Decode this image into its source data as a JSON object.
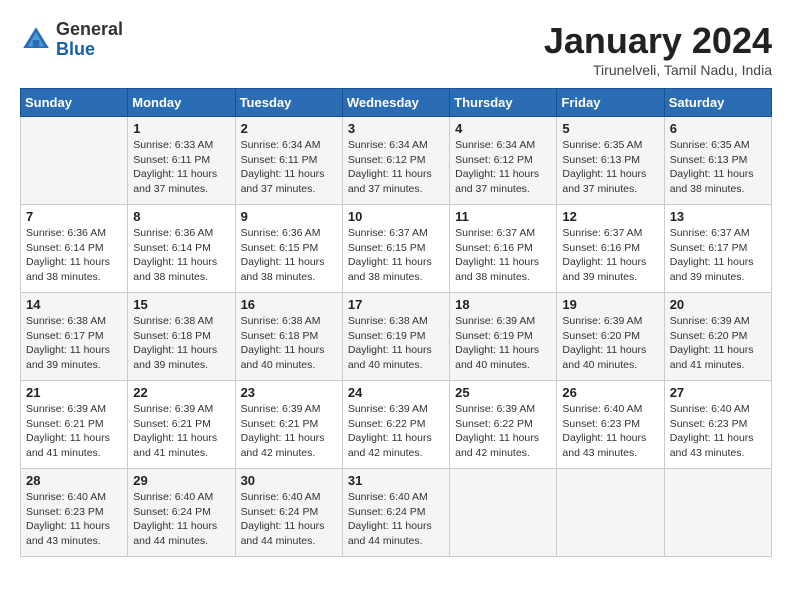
{
  "header": {
    "logo": {
      "general": "General",
      "blue": "Blue"
    },
    "title": "January 2024",
    "location": "Tirunelveli, Tamil Nadu, India"
  },
  "calendar": {
    "days_of_week": [
      "Sunday",
      "Monday",
      "Tuesday",
      "Wednesday",
      "Thursday",
      "Friday",
      "Saturday"
    ],
    "weeks": [
      [
        {
          "day": "",
          "info": ""
        },
        {
          "day": "1",
          "info": "Sunrise: 6:33 AM\nSunset: 6:11 PM\nDaylight: 11 hours\nand 37 minutes."
        },
        {
          "day": "2",
          "info": "Sunrise: 6:34 AM\nSunset: 6:11 PM\nDaylight: 11 hours\nand 37 minutes."
        },
        {
          "day": "3",
          "info": "Sunrise: 6:34 AM\nSunset: 6:12 PM\nDaylight: 11 hours\nand 37 minutes."
        },
        {
          "day": "4",
          "info": "Sunrise: 6:34 AM\nSunset: 6:12 PM\nDaylight: 11 hours\nand 37 minutes."
        },
        {
          "day": "5",
          "info": "Sunrise: 6:35 AM\nSunset: 6:13 PM\nDaylight: 11 hours\nand 37 minutes."
        },
        {
          "day": "6",
          "info": "Sunrise: 6:35 AM\nSunset: 6:13 PM\nDaylight: 11 hours\nand 38 minutes."
        }
      ],
      [
        {
          "day": "7",
          "info": "Sunrise: 6:36 AM\nSunset: 6:14 PM\nDaylight: 11 hours\nand 38 minutes."
        },
        {
          "day": "8",
          "info": "Sunrise: 6:36 AM\nSunset: 6:14 PM\nDaylight: 11 hours\nand 38 minutes."
        },
        {
          "day": "9",
          "info": "Sunrise: 6:36 AM\nSunset: 6:15 PM\nDaylight: 11 hours\nand 38 minutes."
        },
        {
          "day": "10",
          "info": "Sunrise: 6:37 AM\nSunset: 6:15 PM\nDaylight: 11 hours\nand 38 minutes."
        },
        {
          "day": "11",
          "info": "Sunrise: 6:37 AM\nSunset: 6:16 PM\nDaylight: 11 hours\nand 38 minutes."
        },
        {
          "day": "12",
          "info": "Sunrise: 6:37 AM\nSunset: 6:16 PM\nDaylight: 11 hours\nand 39 minutes."
        },
        {
          "day": "13",
          "info": "Sunrise: 6:37 AM\nSunset: 6:17 PM\nDaylight: 11 hours\nand 39 minutes."
        }
      ],
      [
        {
          "day": "14",
          "info": "Sunrise: 6:38 AM\nSunset: 6:17 PM\nDaylight: 11 hours\nand 39 minutes."
        },
        {
          "day": "15",
          "info": "Sunrise: 6:38 AM\nSunset: 6:18 PM\nDaylight: 11 hours\nand 39 minutes."
        },
        {
          "day": "16",
          "info": "Sunrise: 6:38 AM\nSunset: 6:18 PM\nDaylight: 11 hours\nand 40 minutes."
        },
        {
          "day": "17",
          "info": "Sunrise: 6:38 AM\nSunset: 6:19 PM\nDaylight: 11 hours\nand 40 minutes."
        },
        {
          "day": "18",
          "info": "Sunrise: 6:39 AM\nSunset: 6:19 PM\nDaylight: 11 hours\nand 40 minutes."
        },
        {
          "day": "19",
          "info": "Sunrise: 6:39 AM\nSunset: 6:20 PM\nDaylight: 11 hours\nand 40 minutes."
        },
        {
          "day": "20",
          "info": "Sunrise: 6:39 AM\nSunset: 6:20 PM\nDaylight: 11 hours\nand 41 minutes."
        }
      ],
      [
        {
          "day": "21",
          "info": "Sunrise: 6:39 AM\nSunset: 6:21 PM\nDaylight: 11 hours\nand 41 minutes."
        },
        {
          "day": "22",
          "info": "Sunrise: 6:39 AM\nSunset: 6:21 PM\nDaylight: 11 hours\nand 41 minutes."
        },
        {
          "day": "23",
          "info": "Sunrise: 6:39 AM\nSunset: 6:21 PM\nDaylight: 11 hours\nand 42 minutes."
        },
        {
          "day": "24",
          "info": "Sunrise: 6:39 AM\nSunset: 6:22 PM\nDaylight: 11 hours\nand 42 minutes."
        },
        {
          "day": "25",
          "info": "Sunrise: 6:39 AM\nSunset: 6:22 PM\nDaylight: 11 hours\nand 42 minutes."
        },
        {
          "day": "26",
          "info": "Sunrise: 6:40 AM\nSunset: 6:23 PM\nDaylight: 11 hours\nand 43 minutes."
        },
        {
          "day": "27",
          "info": "Sunrise: 6:40 AM\nSunset: 6:23 PM\nDaylight: 11 hours\nand 43 minutes."
        }
      ],
      [
        {
          "day": "28",
          "info": "Sunrise: 6:40 AM\nSunset: 6:23 PM\nDaylight: 11 hours\nand 43 minutes."
        },
        {
          "day": "29",
          "info": "Sunrise: 6:40 AM\nSunset: 6:24 PM\nDaylight: 11 hours\nand 44 minutes."
        },
        {
          "day": "30",
          "info": "Sunrise: 6:40 AM\nSunset: 6:24 PM\nDaylight: 11 hours\nand 44 minutes."
        },
        {
          "day": "31",
          "info": "Sunrise: 6:40 AM\nSunset: 6:24 PM\nDaylight: 11 hours\nand 44 minutes."
        },
        {
          "day": "",
          "info": ""
        },
        {
          "day": "",
          "info": ""
        },
        {
          "day": "",
          "info": ""
        }
      ]
    ]
  }
}
